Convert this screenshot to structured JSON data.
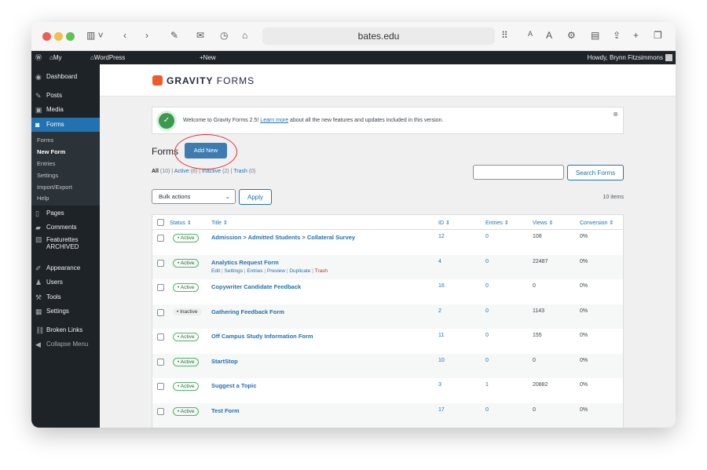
{
  "browser": {
    "url": "bates.edu"
  },
  "adminbar": {
    "my_sites": "My Sites",
    "site": "WordPress Community of Practice",
    "new": "New",
    "howdy": "Howdy, Brynn Fitzsimmons"
  },
  "sidebar": {
    "dashboard": "Dashboard",
    "posts": "Posts",
    "media": "Media",
    "forms": "Forms",
    "sub": [
      "Forms",
      "New Form",
      "Entries",
      "Settings",
      "Import/Export",
      "Help"
    ],
    "pages": "Pages",
    "comments": "Comments",
    "featurettes": "Featurettes",
    "archived": "ARCHIVED",
    "appearance": "Appearance",
    "users": "Users",
    "tools": "Tools",
    "settings": "Settings",
    "broken_links": "Broken Links",
    "collapse": "Collapse Menu"
  },
  "logo": {
    "gravity": "GRAVITY",
    "forms": "FORMS"
  },
  "notice": {
    "text": "Welcome to Gravity Forms 2.5!",
    "link": "Learn more",
    "rest": "about all the new features and updates included in this version."
  },
  "page": {
    "title": "Forms",
    "add_new": "Add New",
    "filters": {
      "all": "All",
      "all_count": "(10)",
      "active": "Active",
      "active_count": "(8)",
      "inactive": "Inactive",
      "inactive_count": "(2)",
      "trash": "Trash",
      "trash_count": "(0)"
    },
    "search_button": "Search Forms",
    "bulk": "Bulk actions",
    "apply": "Apply",
    "count": "10 items"
  },
  "table": {
    "headers": [
      "Status",
      "Title",
      "ID",
      "Entries",
      "Views",
      "Conversion"
    ],
    "row_actions": [
      "Edit",
      "Settings",
      "Entries",
      "Preview",
      "Duplicate",
      "Trash"
    ],
    "rows": [
      {
        "status": "Active",
        "title": "Admission > Admitted Students > Collateral Survey",
        "id": "12",
        "entries": "0",
        "views": "108",
        "conversion": "0%"
      },
      {
        "status": "Active",
        "title": "Analytics Request Form",
        "id": "4",
        "entries": "0",
        "views": "22487",
        "conversion": "0%"
      },
      {
        "status": "Active",
        "title": "Copywriter Candidate Feedback",
        "id": "16",
        "entries": "0",
        "views": "0",
        "conversion": "0%"
      },
      {
        "status": "Inactive",
        "title": "Gathering Feedback Form",
        "id": "2",
        "entries": "0",
        "views": "1143",
        "conversion": "0%"
      },
      {
        "status": "Active",
        "title": "Off Campus Study Information Form",
        "id": "11",
        "entries": "0",
        "views": "155",
        "conversion": "0%"
      },
      {
        "status": "Active",
        "title": "StartStop",
        "id": "10",
        "entries": "0",
        "views": "0",
        "conversion": "0%"
      },
      {
        "status": "Active",
        "title": "Suggest a Topic",
        "id": "3",
        "entries": "1",
        "views": "20882",
        "conversion": "0%"
      },
      {
        "status": "Active",
        "title": "Test Form",
        "id": "17",
        "entries": "0",
        "views": "0",
        "conversion": "0%"
      }
    ]
  }
}
